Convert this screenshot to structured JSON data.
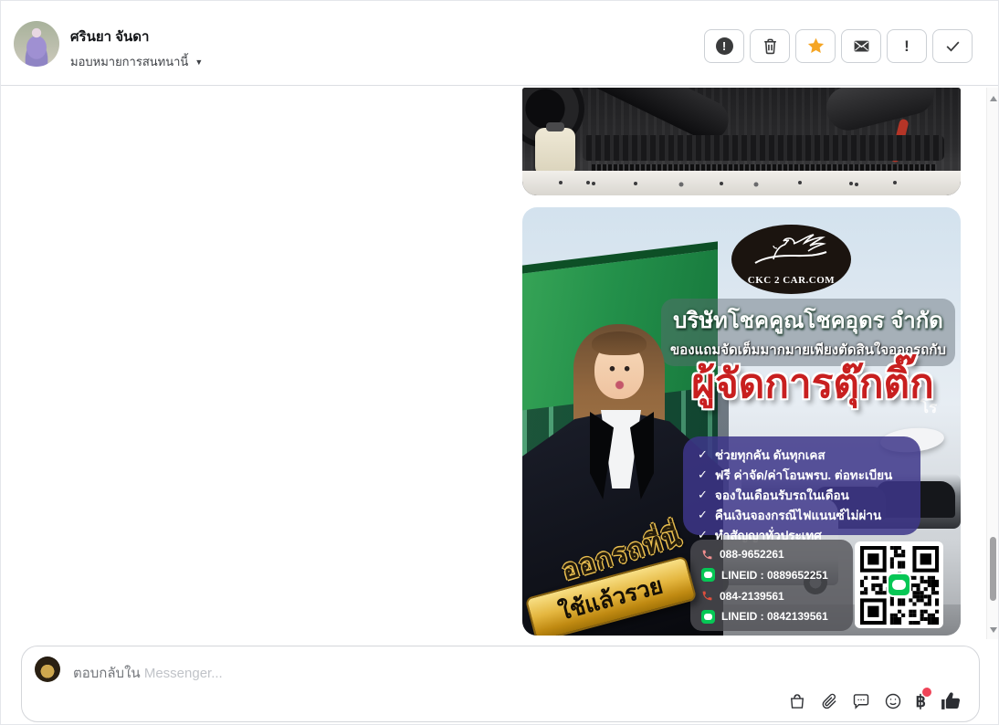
{
  "header": {
    "name": "ศรินยา จันดา",
    "assign_label": "มอบหมายการสนทนานี้",
    "actions": [
      {
        "name": "mark-spam",
        "icon": "exclamation-circle-icon"
      },
      {
        "name": "delete",
        "icon": "trash-icon"
      },
      {
        "name": "star",
        "icon": "star-icon",
        "color": "#f5a523"
      },
      {
        "name": "mark-unread",
        "icon": "envelope-icon"
      },
      {
        "name": "mark-important",
        "icon": "exclamation-icon"
      },
      {
        "name": "mark-done",
        "icon": "check-icon"
      }
    ]
  },
  "conversation": {
    "messages": [
      {
        "type": "image",
        "alt": "car engine bay photo"
      },
      {
        "type": "image",
        "alt": "CKC 2 CAR dealership promotion banner"
      }
    ]
  },
  "promo": {
    "logo_text": "CKC 2 CAR.COM",
    "company": "บริษัทโชคคูณโชคอุดร จำกัด",
    "subtitle": "ของแถมจัดเต็มมากมายเพียงตัดสินใจออกรถกับ",
    "title": "ผู้จัดการตุ๊กติ๊ก",
    "bg_sign": "โร",
    "checklist": [
      "ช่วยทุกคัน ดันทุกเคส",
      "ฟรี ค่าจัด/ค่าโอนพรบ. ต่อทะเบียน",
      "จองในเดือนรับรถในเดือน",
      "คืนเงินจองกรณีไฟแนนซ์ไม่ผ่าน",
      "ทำสัญญาทั่วประเทศ"
    ],
    "contacts": [
      {
        "icon": "phone-icon",
        "label": "088-9652261"
      },
      {
        "icon": "line-icon",
        "label": "LINEID : 0889652251"
      },
      {
        "icon": "phone-icon",
        "label": "084-2139561"
      },
      {
        "icon": "line-icon",
        "label": "LINEID : 0842139561"
      }
    ],
    "ribbon_top": "ออกรถที่นี่",
    "ribbon_bottom": "ใช้แล้วรวย"
  },
  "composer": {
    "placeholder_prefix": "ตอบกลับใน",
    "placeholder_suffix": "Messenger...",
    "icons": [
      "bag-icon",
      "paperclip-icon",
      "chat-bubble-icon",
      "emoji-icon",
      "baht-icon",
      "like-icon"
    ]
  },
  "icons": {
    "caret_down": "▼",
    "check": "✓",
    "exclamation": "!",
    "baht": "฿"
  },
  "colors": {
    "star": "#f5a523",
    "line_green": "#06c755",
    "phone_pink": "#f08e8e",
    "phone_red": "#e2503e",
    "title_red": "#c81f1f",
    "checklist_bg": "#3d368a",
    "notification_dot": "#ef4458"
  }
}
